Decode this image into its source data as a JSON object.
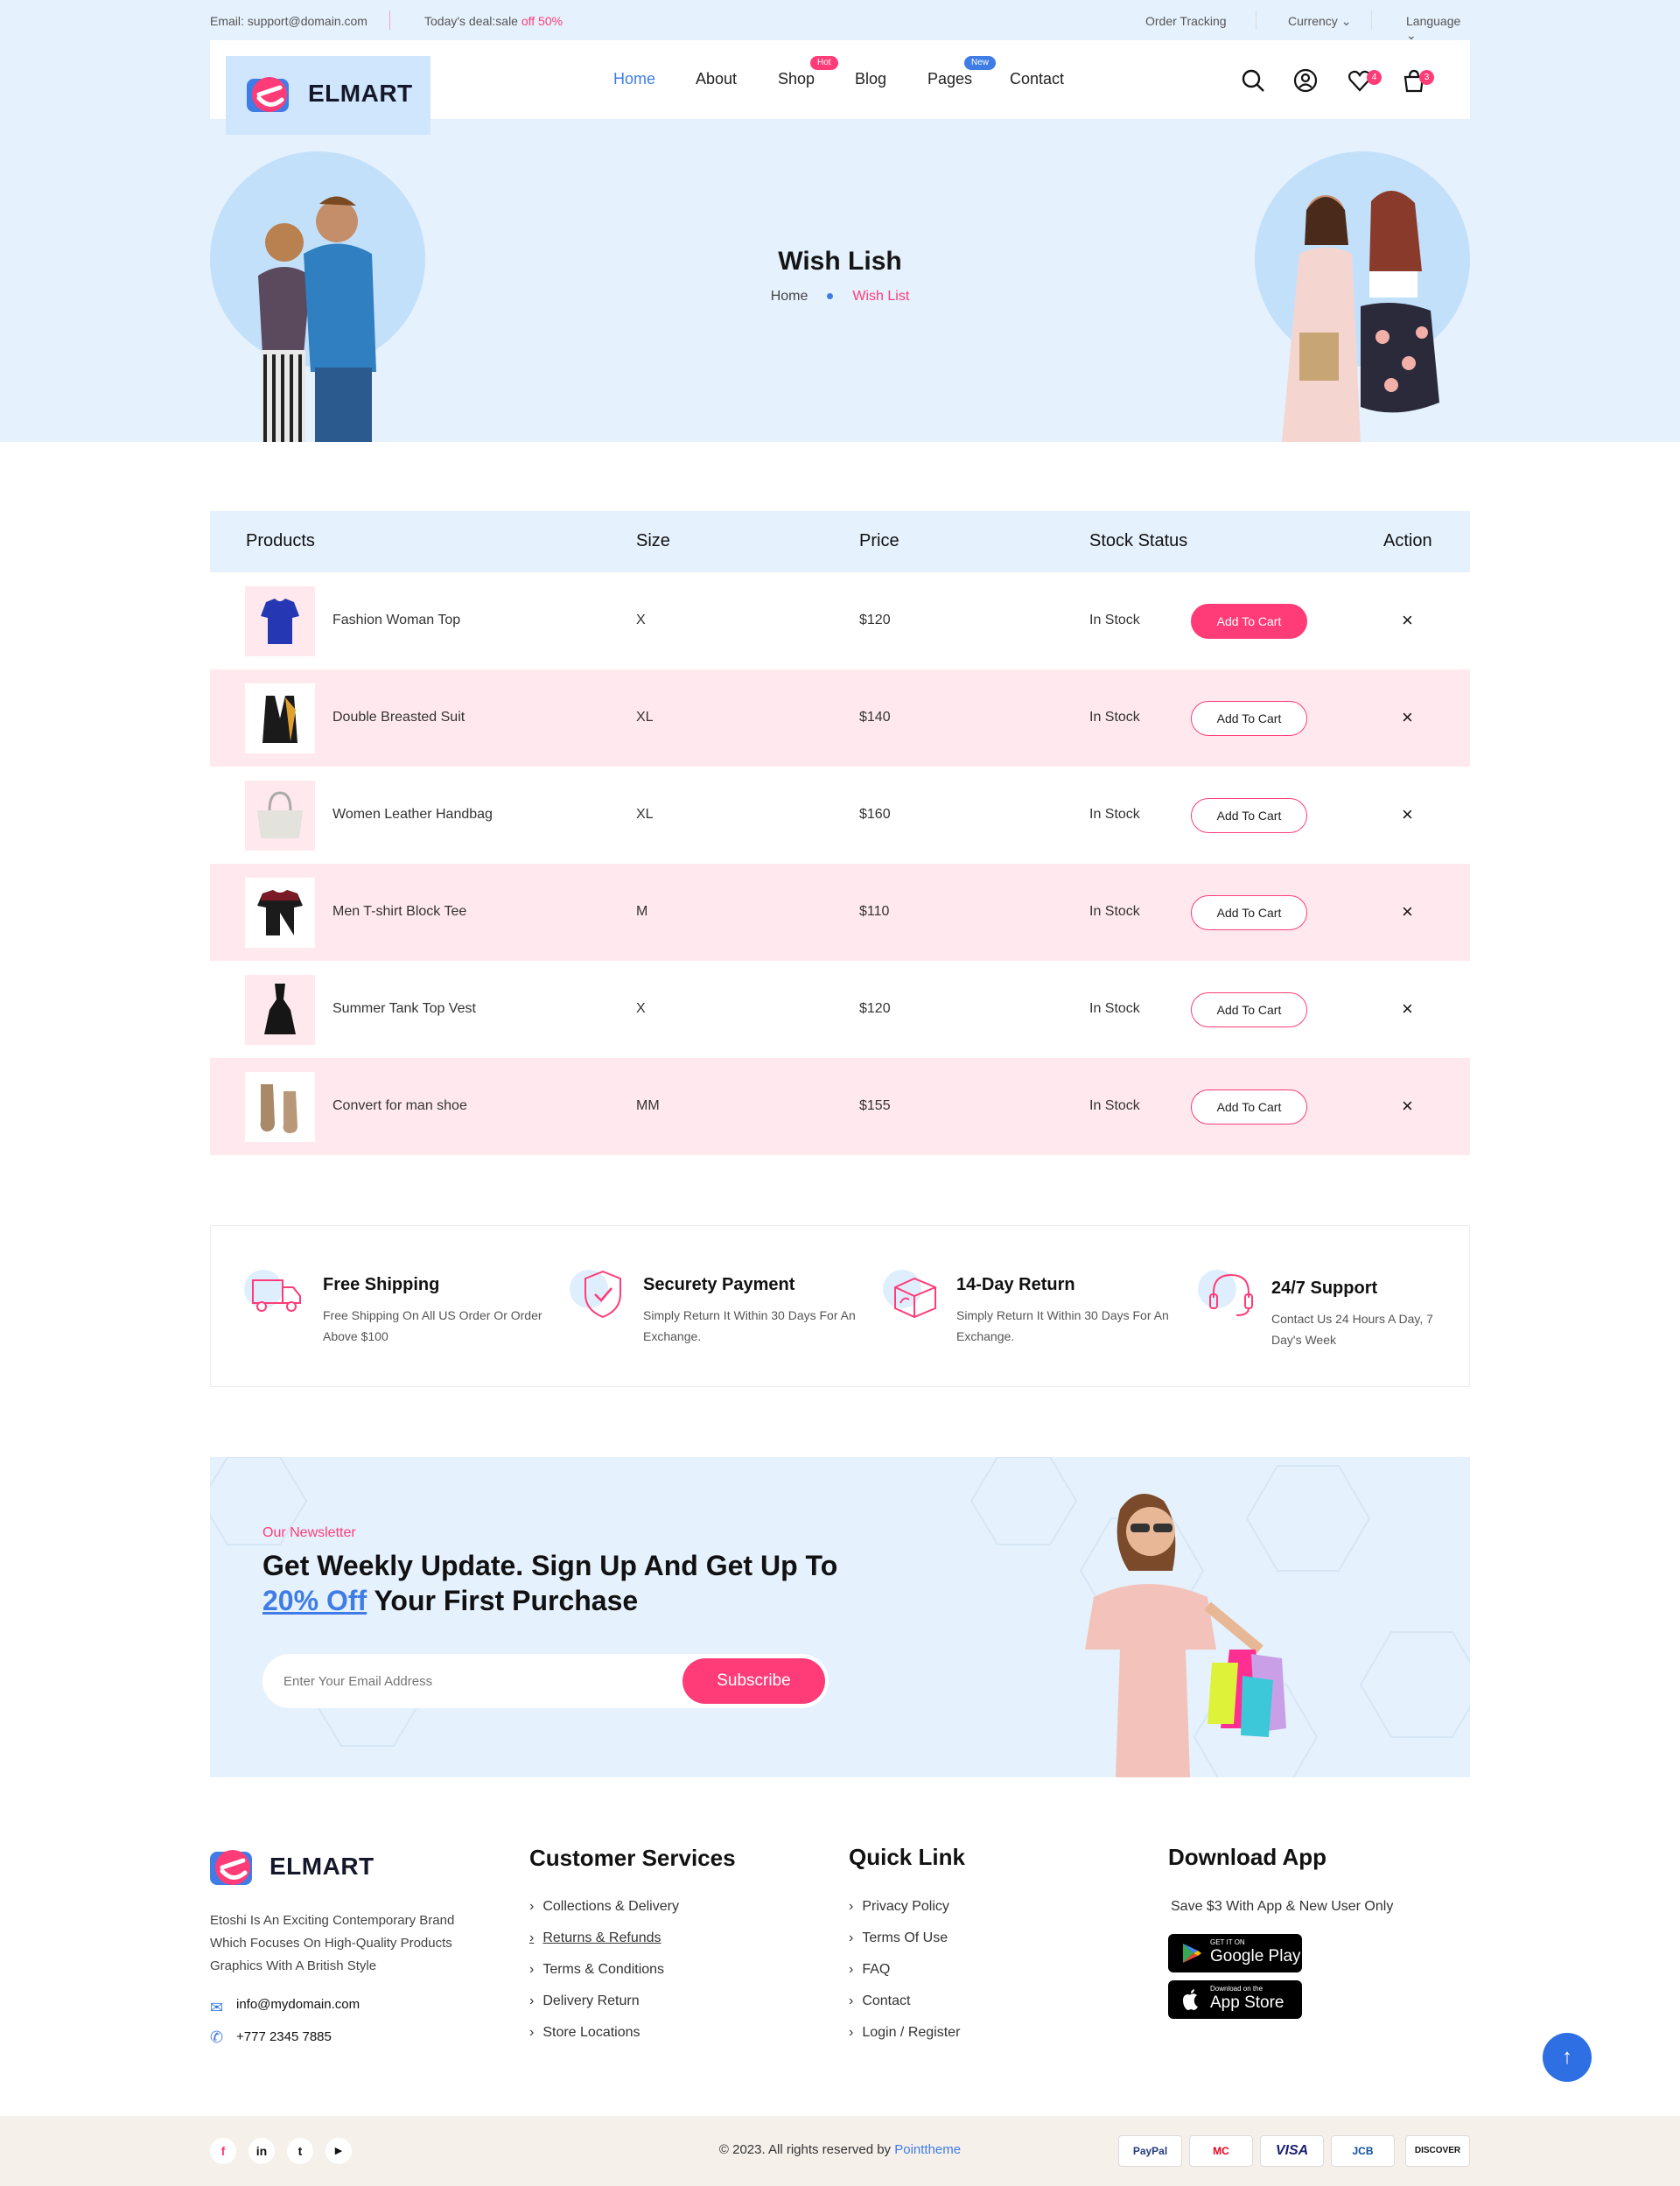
{
  "topbar": {
    "email": "Email: support@domain.com",
    "deal_prefix": "Today's deal:sale",
    "deal_highlight": "off 50%",
    "order_tracking": "Order Tracking",
    "currency": "Currency",
    "language": "Language"
  },
  "header": {
    "brand": "ELMART",
    "nav": [
      "Home",
      "About",
      "Shop",
      "Blog",
      "Pages",
      "Contact"
    ],
    "badge_hot": "Hot",
    "badge_new": "New",
    "wishlist_count": "4",
    "cart_count": "3"
  },
  "hero": {
    "title": "Wish Lish",
    "crumb_home": "Home",
    "crumb_current": "Wish List"
  },
  "table": {
    "headers": {
      "products": "Products",
      "size": "Size",
      "price": "Price",
      "stock": "Stock Status",
      "action": "Action"
    },
    "add_label": "Add To Cart",
    "remove_glyph": "×",
    "rows": [
      {
        "name": "Fashion Woman Top",
        "size": "X",
        "price": "$120",
        "stock": "In Stock"
      },
      {
        "name": "Double Breasted Suit",
        "size": "XL",
        "price": "$140",
        "stock": "In Stock"
      },
      {
        "name": "Women Leather Handbag",
        "size": "XL",
        "price": "$160",
        "stock": "In Stock"
      },
      {
        "name": "Men T-shirt Block Tee",
        "size": "M",
        "price": "$110",
        "stock": "In Stock"
      },
      {
        "name": "Summer Tank Top Vest",
        "size": "X",
        "price": "$120",
        "stock": "In Stock"
      },
      {
        "name": "Convert for man shoe",
        "size": "MM",
        "price": "$155",
        "stock": "In Stock"
      }
    ]
  },
  "features": [
    {
      "title": "Free Shipping",
      "desc": "Free Shipping On All US Order Or Order Above $100"
    },
    {
      "title": "Securety Payment",
      "desc": "Simply Return It Within 30 Days For An Exchange."
    },
    {
      "title": "14-Day Return",
      "desc": "Simply Return It Within 30 Days For An Exchange."
    },
    {
      "title": "24/7 Support",
      "desc": "Contact Us 24 Hours A Day, 7 Day's Week"
    }
  ],
  "newsletter": {
    "tag": "Our Newsletter",
    "line1": "Get Weekly Update. Sign Up And Get Up To",
    "highlight": "20% Off",
    "line2_rest": " Your First Purchase",
    "placeholder": "Enter Your Email Address",
    "button": "Subscribe"
  },
  "footer": {
    "brand": "ELMART",
    "about": "Etoshi Is An Exciting Contemporary Brand Which Focuses On High-Quality Products Graphics With A British Style",
    "email": "info@mydomain.com",
    "phone": "+777 2345 7885",
    "customer_title": "Customer Services",
    "customer_links": [
      "Collections & Delivery",
      "Returns & Refunds",
      "Terms & Conditions",
      "Delivery Return",
      "Store Locations"
    ],
    "quick_title": "Quick Link",
    "quick_links": [
      "Privacy Policy",
      "Terms Of Use",
      "FAQ",
      "Contact",
      "Login / Register"
    ],
    "app_title": "Download App",
    "app_sub": "Save $3 With App & New User Only",
    "gp_small": "GET IT ON",
    "gp_big": "Google Play",
    "as_small": "Download on the",
    "as_big": "App Store",
    "copyright_prefix": "© 2023. All rights reserved by",
    "copyright_brand": "Pointtheme",
    "social": [
      "f",
      "in",
      "t",
      "▶"
    ],
    "payments": [
      "PayPal",
      "MC",
      "VISA",
      "JCB",
      "DISCOVER"
    ]
  },
  "colors": {
    "accent": "#ff3c78",
    "blue": "#3f7ce6",
    "light": "#e5f1fd",
    "pink": "#ffe9ee"
  }
}
